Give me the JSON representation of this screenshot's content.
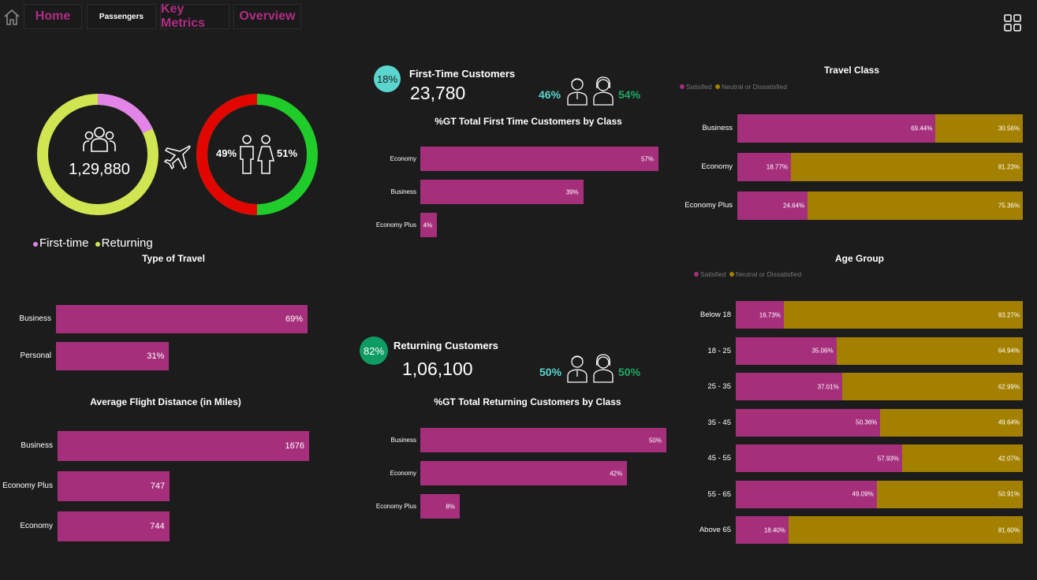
{
  "nav": {
    "home": "Home",
    "passengers": "Passengers",
    "key_metrics": "Key Metrics",
    "overview": "Overview"
  },
  "overview": {
    "total": "1,29,880",
    "female_pct": "49%",
    "male_pct": "51%",
    "legend_first": "First-time",
    "legend_returning": "Returning",
    "first_time_share": 0.18
  },
  "first_time": {
    "badge": "18%",
    "title": "First-Time Customers",
    "count": "23,780",
    "male_pct": "46%",
    "female_pct": "54%"
  },
  "returning": {
    "badge": "82%",
    "title": "Returning Customers",
    "count": "1,06,100",
    "male_pct": "50%",
    "female_pct": "50%"
  },
  "colors": {
    "bar": "#a62f7c",
    "neutral": "#a38000",
    "lime": "#cfe551",
    "violet": "#e284e8",
    "green": "#1fcc2a",
    "red": "#e10600",
    "teal": "#5ad6cf",
    "green_badge": "#0f9c62"
  },
  "chart_data": [
    {
      "type": "bar",
      "title": "Type of Travel",
      "categories": [
        "Business",
        "Personal"
      ],
      "values": [
        69,
        31
      ],
      "labels": [
        "69%",
        "31%"
      ]
    },
    {
      "type": "bar",
      "title": "Average Flight Distance (in Miles)",
      "categories": [
        "Business",
        "Economy Plus",
        "Economy"
      ],
      "values": [
        1676,
        747,
        744
      ],
      "labels": [
        "1676",
        "747",
        "744"
      ]
    },
    {
      "type": "bar",
      "title": "%GT Total First Time Customers by Class",
      "categories": [
        "Economy",
        "Business",
        "Economy Plus"
      ],
      "values": [
        57,
        39,
        4
      ],
      "labels": [
        "57%",
        "39%",
        "4%"
      ]
    },
    {
      "type": "bar",
      "title": "%GT Total Returning Customers by Class",
      "categories": [
        "Business",
        "Economy",
        "Economy Plus"
      ],
      "values": [
        50,
        42,
        8
      ],
      "labels": [
        "50%",
        "42%",
        "8%"
      ]
    },
    {
      "type": "bar",
      "stacked": true,
      "title": "Travel Class",
      "legend": [
        "Satisfied",
        "Neutral or Dissatisfied"
      ],
      "categories": [
        "Business",
        "Economy",
        "Economy Plus"
      ],
      "series": [
        {
          "name": "Satisfied",
          "values": [
            69.44,
            18.77,
            24.64
          ],
          "labels": [
            "69.44%",
            "18.77%",
            "24.64%"
          ]
        },
        {
          "name": "Neutral or Dissatisfied",
          "values": [
            30.56,
            81.23,
            75.36
          ],
          "labels": [
            "30.56%",
            "81.23%",
            "75.36%"
          ]
        }
      ]
    },
    {
      "type": "bar",
      "stacked": true,
      "title": "Age Group",
      "legend": [
        "Satisfied",
        "Neutral or Dissatisfied"
      ],
      "categories": [
        "Below 18",
        "18 - 25",
        "25 - 35",
        "35 - 45",
        "45 - 55",
        "55 - 65",
        "Above 65"
      ],
      "series": [
        {
          "name": "Satisfied",
          "values": [
            16.73,
            35.06,
            37.01,
            50.36,
            57.93,
            49.09,
            18.4
          ],
          "labels": [
            "16.73%",
            "35.06%",
            "37.01%",
            "50.36%",
            "57.93%",
            "49.09%",
            "18.40%"
          ]
        },
        {
          "name": "Neutral or Dissatisfied",
          "values": [
            83.27,
            64.94,
            62.99,
            49.64,
            42.07,
            50.91,
            81.6
          ],
          "labels": [
            "83.27%",
            "64.94%",
            "62.99%",
            "49.64%",
            "42.07%",
            "50.91%",
            "81.60%"
          ]
        }
      ]
    }
  ]
}
